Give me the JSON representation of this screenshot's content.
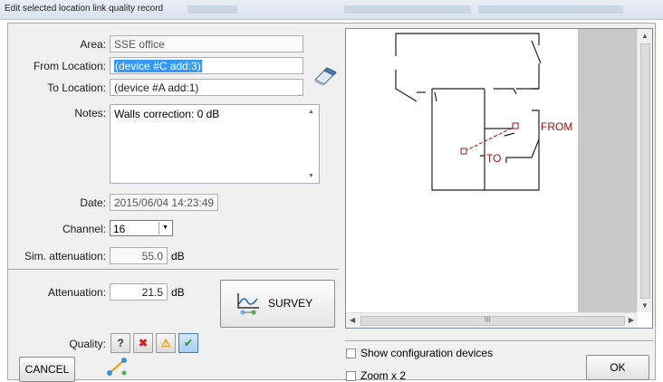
{
  "window": {
    "title": "Edit selected location link quality record"
  },
  "form": {
    "area_label": "Area:",
    "area_value": "SSE office",
    "from_label": "From Location:",
    "from_value": "(device #C add:3)",
    "to_label": "To Location:",
    "to_value": "(device #A add:1)",
    "notes_label": "Notes:",
    "notes_value": "Walls correction: 0 dB",
    "date_label": "Date:",
    "date_value": "2015/06/04 14:23:49",
    "channel_label": "Channel:",
    "channel_value": "16",
    "sim_label": "Sim. attenuation:",
    "sim_value": "55.0",
    "sim_unit": "dB",
    "att_label": "Attenuation:",
    "att_value": "21.5",
    "att_unit": "dB",
    "quality_label": "Quality:",
    "quality_buttons": [
      "?",
      "✖",
      "⚠",
      "✔"
    ],
    "quality_selected": "good"
  },
  "survey_button": {
    "label": "SURVEY"
  },
  "map": {
    "from_label": "FROM",
    "to_label": "TO",
    "scroll_h_text": "III"
  },
  "footer": {
    "cancel_label": "CANCEL",
    "ok_label": "OK",
    "show_config_label": "Show configuration devices",
    "zoom_label": "Zoom x 2"
  },
  "colors": {
    "selection": "#3399ff",
    "map_marker": "#a01010",
    "good": "#2fa82f",
    "bad": "#d81e1e",
    "warn": "#f2b705"
  }
}
